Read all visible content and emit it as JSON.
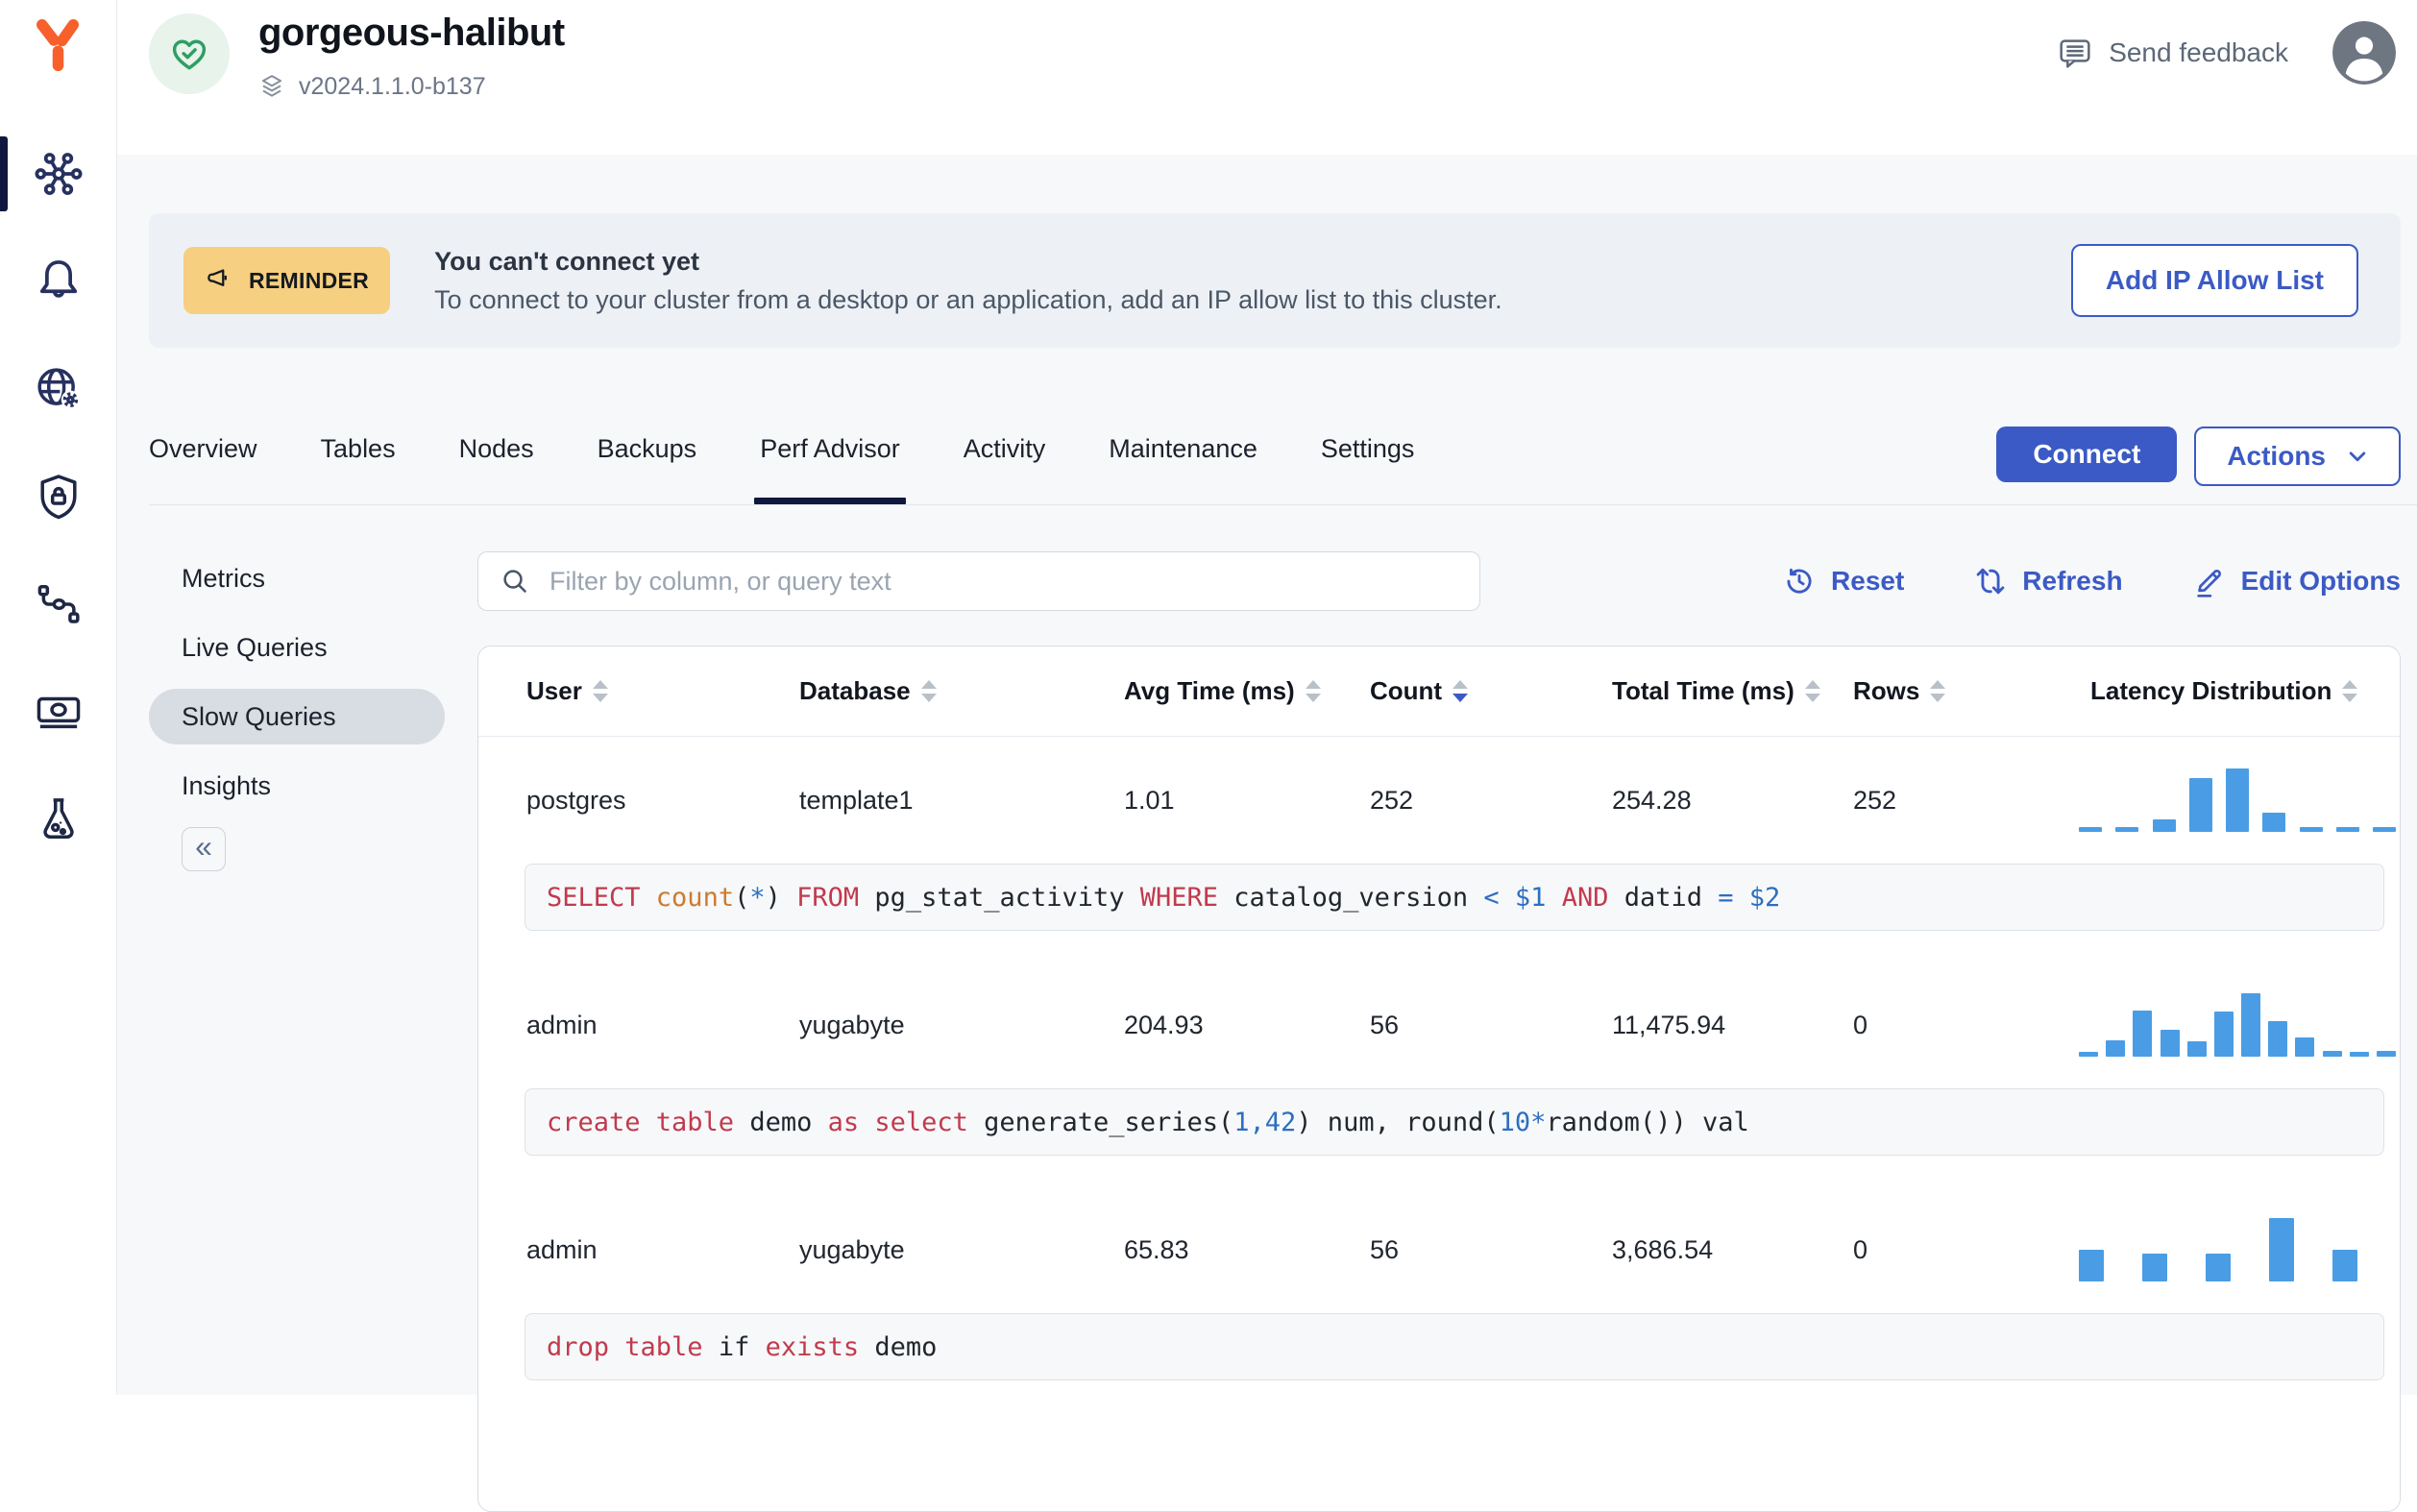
{
  "colors": {
    "accent_blue": "#3b5ac5",
    "histogram_bar": "#4a9de5",
    "reminder_badge_bg": "#f6cf80",
    "logo_orange": "#f75f2b",
    "tab_underline": "#10183f",
    "health_green": "#2f9e63",
    "sql_keyword": "#c13a4d",
    "sql_function": "#cf7a2e",
    "sql_number": "#2d6fc0"
  },
  "sidebar": {
    "items": [
      {
        "name": "clusters",
        "active": true
      },
      {
        "name": "alerts",
        "active": false
      },
      {
        "name": "network",
        "active": false
      },
      {
        "name": "security",
        "active": false
      },
      {
        "name": "integrations",
        "active": false
      },
      {
        "name": "billing",
        "active": false
      },
      {
        "name": "labs",
        "active": false
      }
    ]
  },
  "topbar": {
    "cluster_name": "gorgeous-halibut",
    "version": "v2024.1.1.0-b137",
    "send_feedback_label": "Send feedback"
  },
  "banner": {
    "badge": "REMINDER",
    "title": "You can't connect yet",
    "message": "To connect to your cluster from a desktop or an application, add an IP allow list to this cluster.",
    "action_label": "Add IP Allow List"
  },
  "tabs": {
    "items": [
      "Overview",
      "Tables",
      "Nodes",
      "Backups",
      "Perf Advisor",
      "Activity",
      "Maintenance",
      "Settings"
    ],
    "active": "Perf Advisor"
  },
  "cluster_actions": {
    "connect_label": "Connect",
    "actions_label": "Actions"
  },
  "subnav": {
    "items": [
      "Metrics",
      "Live Queries",
      "Slow Queries",
      "Insights"
    ],
    "active": "Slow Queries",
    "collapse_label": "«"
  },
  "toolbar": {
    "filter_placeholder": "Filter by column, or query text",
    "reset_label": "Reset",
    "refresh_label": "Refresh",
    "edit_options_label": "Edit Options"
  },
  "table": {
    "columns": [
      "User",
      "Database",
      "Avg Time (ms)",
      "Count",
      "Total Time (ms)",
      "Rows",
      "Latency Distribution"
    ],
    "sort_column": "Count",
    "sort_direction": "desc",
    "rows": [
      {
        "user": "postgres",
        "database": "template1",
        "avg_time_ms": "1.01",
        "count": "252",
        "total_time_ms": "254.28",
        "rows": "252",
        "histogram": [
          7,
          7,
          20,
          85,
          100,
          30,
          8,
          7,
          7
        ],
        "query_tokens": [
          {
            "t": "SELECT ",
            "c": "kw"
          },
          {
            "t": "count",
            "c": "fn"
          },
          {
            "t": "(",
            "c": "plain"
          },
          {
            "t": "*",
            "c": "num"
          },
          {
            "t": ") ",
            "c": "plain"
          },
          {
            "t": "FROM ",
            "c": "kw"
          },
          {
            "t": "pg_stat_activity ",
            "c": "plain"
          },
          {
            "t": "WHERE ",
            "c": "kw"
          },
          {
            "t": "catalog_version ",
            "c": "plain"
          },
          {
            "t": "< ",
            "c": "num"
          },
          {
            "t": "$1 ",
            "c": "num"
          },
          {
            "t": "AND ",
            "c": "kw"
          },
          {
            "t": "datid ",
            "c": "plain"
          },
          {
            "t": "= ",
            "c": "num"
          },
          {
            "t": "$2",
            "c": "num"
          }
        ]
      },
      {
        "user": "admin",
        "database": "yugabyte",
        "avg_time_ms": "204.93",
        "count": "56",
        "total_time_ms": "11,475.94",
        "rows": "0",
        "histogram": [
          8,
          26,
          72,
          42,
          24,
          71,
          100,
          56,
          31,
          9,
          8,
          9
        ],
        "query_tokens": [
          {
            "t": "create table ",
            "c": "kw"
          },
          {
            "t": "demo ",
            "c": "plain"
          },
          {
            "t": "as select ",
            "c": "kw"
          },
          {
            "t": "generate_series(",
            "c": "plain"
          },
          {
            "t": "1,42",
            "c": "num"
          },
          {
            "t": ") num, round(",
            "c": "plain"
          },
          {
            "t": "10",
            "c": "num"
          },
          {
            "t": "*",
            "c": "num"
          },
          {
            "t": "random()) val",
            "c": "plain"
          }
        ]
      },
      {
        "user": "admin",
        "database": "yugabyte",
        "avg_time_ms": "65.83",
        "count": "56",
        "total_time_ms": "3,686.54",
        "rows": "0",
        "histogram": [
          50,
          44,
          44,
          100,
          50
        ],
        "query_tokens": [
          {
            "t": "drop table ",
            "c": "kw"
          },
          {
            "t": "if ",
            "c": "plain"
          },
          {
            "t": "exists ",
            "c": "kw"
          },
          {
            "t": "demo",
            "c": "plain"
          }
        ]
      }
    ]
  }
}
